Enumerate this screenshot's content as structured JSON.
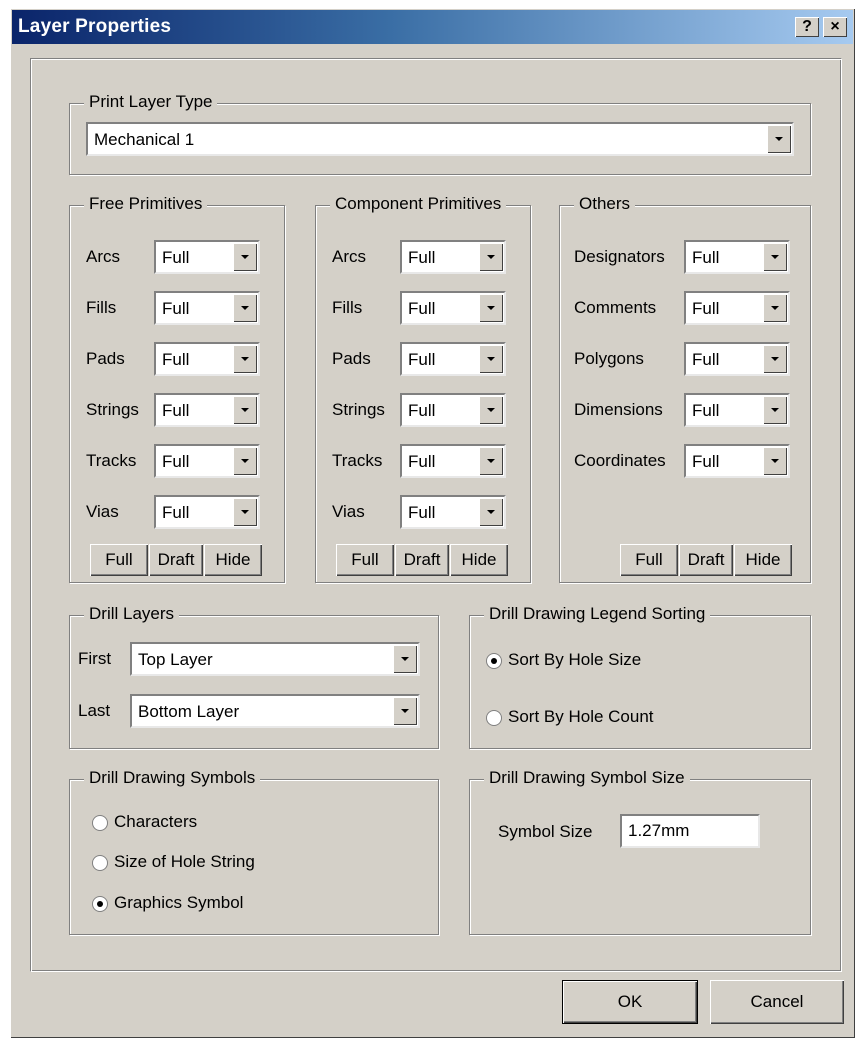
{
  "window": {
    "title": "Layer Properties",
    "help_button": "?",
    "close_button": "×"
  },
  "print_layer_type": {
    "legend": "Print Layer Type",
    "value": "Mechanical 1"
  },
  "free_primitives": {
    "legend": "Free Primitives",
    "rows": [
      {
        "label": "Arcs",
        "value": "Full"
      },
      {
        "label": "Fills",
        "value": "Full"
      },
      {
        "label": "Pads",
        "value": "Full"
      },
      {
        "label": "Strings",
        "value": "Full"
      },
      {
        "label": "Tracks",
        "value": "Full"
      },
      {
        "label": "Vias",
        "value": "Full"
      }
    ],
    "buttons": [
      "Full",
      "Draft",
      "Hide"
    ]
  },
  "component_primitives": {
    "legend": "Component Primitives",
    "rows": [
      {
        "label": "Arcs",
        "value": "Full"
      },
      {
        "label": "Fills",
        "value": "Full"
      },
      {
        "label": "Pads",
        "value": "Full"
      },
      {
        "label": "Strings",
        "value": "Full"
      },
      {
        "label": "Tracks",
        "value": "Full"
      },
      {
        "label": "Vias",
        "value": "Full"
      }
    ],
    "buttons": [
      "Full",
      "Draft",
      "Hide"
    ]
  },
  "others": {
    "legend": "Others",
    "rows": [
      {
        "label": "Designators",
        "value": "Full"
      },
      {
        "label": "Comments",
        "value": "Full"
      },
      {
        "label": "Polygons",
        "value": "Full"
      },
      {
        "label": "Dimensions",
        "value": "Full"
      },
      {
        "label": "Coordinates",
        "value": "Full"
      }
    ],
    "buttons": [
      "Full",
      "Draft",
      "Hide"
    ]
  },
  "drill_layers": {
    "legend": "Drill Layers",
    "first_label": "First",
    "first_value": "Top Layer",
    "last_label": "Last",
    "last_value": "Bottom Layer"
  },
  "legend_sorting": {
    "legend": "Drill Drawing Legend Sorting",
    "options": [
      {
        "label": "Sort By Hole Size",
        "checked": true
      },
      {
        "label": "Sort By Hole Count",
        "checked": false
      }
    ]
  },
  "drill_symbols": {
    "legend": "Drill Drawing Symbols",
    "options": [
      {
        "label": "Characters",
        "checked": false
      },
      {
        "label": "Size of Hole String",
        "checked": false
      },
      {
        "label": "Graphics Symbol",
        "checked": true
      }
    ]
  },
  "symbol_size": {
    "legend": "Drill Drawing Symbol Size",
    "label": "Symbol Size",
    "value": "1.27mm"
  },
  "footer": {
    "ok_label": "OK",
    "cancel_label": "Cancel"
  },
  "colors": {
    "face": "#d4d0c8",
    "title_start": "#0a246a",
    "title_end": "#a6caf0"
  }
}
